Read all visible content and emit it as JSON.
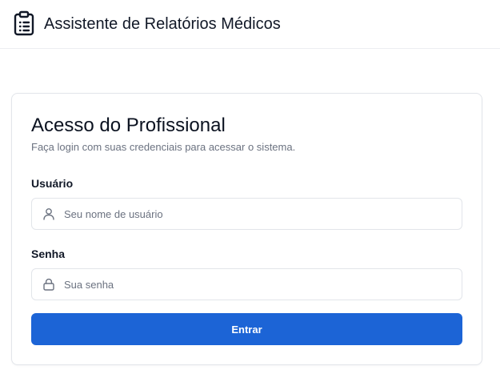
{
  "header": {
    "title": "Assistente de Relatórios Médicos",
    "logo_icon": "clipboard-list-icon"
  },
  "login": {
    "title": "Acesso do Profissional",
    "subtitle": "Faça login com suas credenciais para acessar o sistema.",
    "username": {
      "label": "Usuário",
      "placeholder": "Seu nome de usuário",
      "value": "",
      "icon": "user-icon"
    },
    "password": {
      "label": "Senha",
      "placeholder": "Sua senha",
      "value": "",
      "icon": "lock-icon"
    },
    "submit_label": "Entrar"
  },
  "colors": {
    "primary": "#1c64d6",
    "border": "#e2e5ea",
    "muted_text": "#6b7280"
  }
}
